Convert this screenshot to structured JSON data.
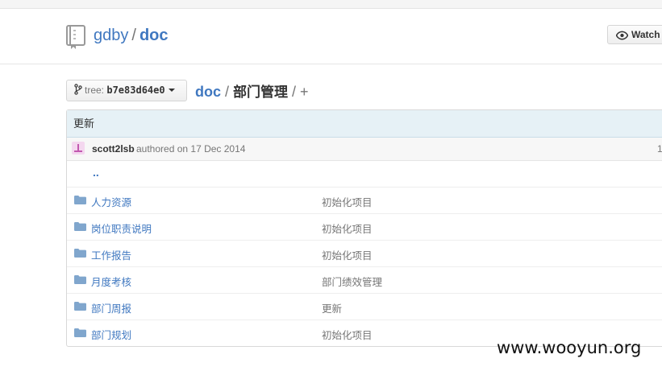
{
  "repo": {
    "owner": "gdby",
    "separator": "/",
    "name": "doc"
  },
  "watch_button": {
    "label": "Watch"
  },
  "branch_select": {
    "label": "tree:",
    "sha": "b7e83d64e0"
  },
  "breadcrumb": {
    "root": "doc",
    "separator": "/",
    "current": "部门管理",
    "trailing_sep": "/",
    "add": "+"
  },
  "commit": {
    "message": "更新",
    "author": "scott2lsb",
    "authored_text": "authored on 17 Dec 2014",
    "right_text": "1"
  },
  "files": {
    "parent": "..",
    "rows": [
      {
        "name": "人力资源",
        "message": "初始化项目",
        "type": "folder-icon"
      },
      {
        "name": "岗位职责说明",
        "message": "初始化项目",
        "type": "folder-icon"
      },
      {
        "name": "工作报告",
        "message": "初始化项目",
        "type": "folder-icon"
      },
      {
        "name": "月度考核",
        "message": "部门绩效管理",
        "type": "folder-icon"
      },
      {
        "name": "部门周报",
        "message": "更新",
        "type": "folder-icon"
      },
      {
        "name": "部门规划",
        "message": "初始化项目",
        "type": "folder-icon"
      }
    ]
  },
  "watermark": "www.wooyun.org",
  "colors": {
    "link": "#4078c0",
    "commit_bg": "#e6f1f6",
    "muted": "#767676"
  }
}
